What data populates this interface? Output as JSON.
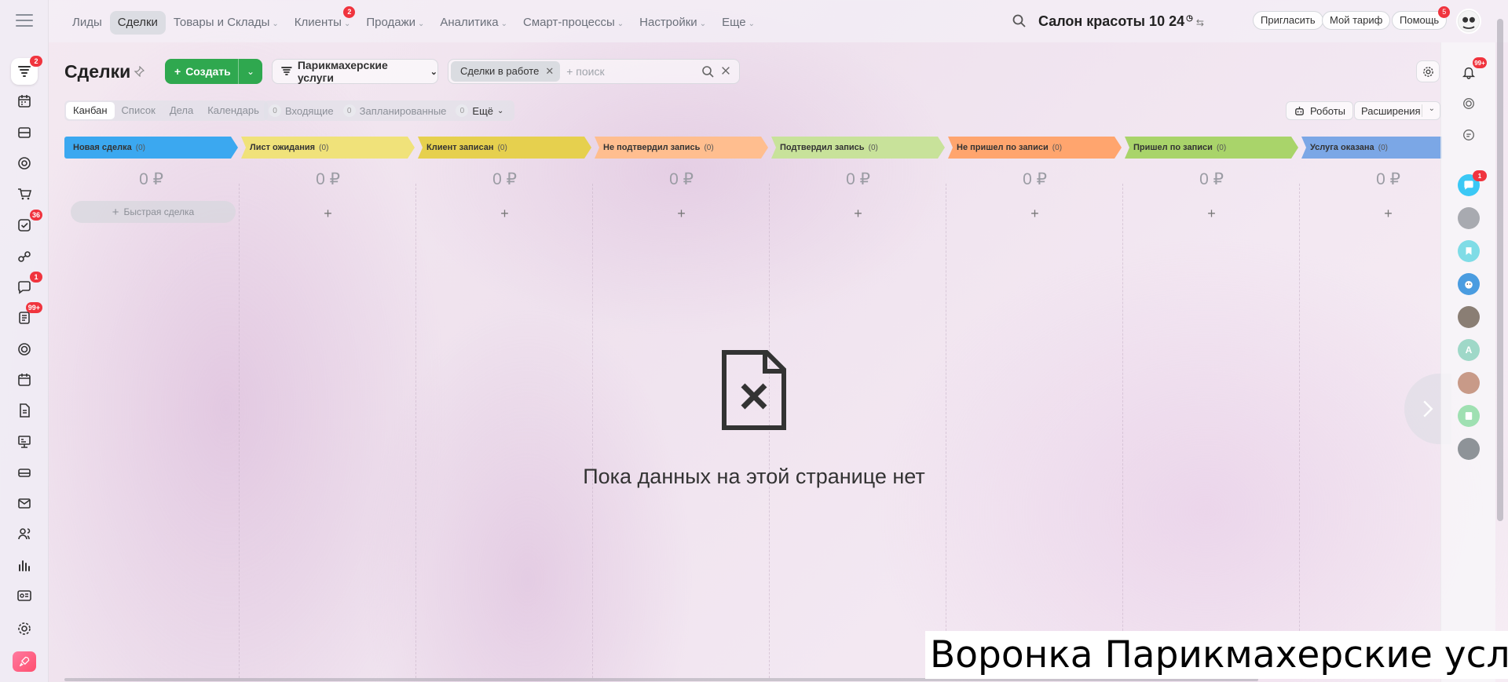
{
  "top_menu": [
    {
      "label": "Лиды",
      "active": false,
      "dropdown": false
    },
    {
      "label": "Сделки",
      "active": true,
      "dropdown": false
    },
    {
      "label": "Товары и Склады",
      "active": false,
      "dropdown": true
    },
    {
      "label": "Клиенты",
      "active": false,
      "dropdown": true,
      "badge": "2"
    },
    {
      "label": "Продажи",
      "active": false,
      "dropdown": true
    },
    {
      "label": "Аналитика",
      "active": false,
      "dropdown": true
    },
    {
      "label": "Смарт-процессы",
      "active": false,
      "dropdown": true
    },
    {
      "label": "Настройки",
      "active": false,
      "dropdown": true
    },
    {
      "label": "Еще",
      "active": false,
      "dropdown": true
    }
  ],
  "header": {
    "company": "Салон красоты 10",
    "clock_time": "24",
    "invite_label": "Пригласить",
    "tariff_label": "Мой тариф",
    "help_label": "Помощь",
    "help_badge": "5"
  },
  "left_nav_badges": {
    "crm": "2",
    "tasks": "36",
    "messenger": "1",
    "feed": "99+"
  },
  "page": {
    "title": "Сделки",
    "create_label": "Создать",
    "pipeline_label": "Парикмахерские услуги",
    "filter_chip": "Сделки в работе",
    "search_placeholder": "+ поиск"
  },
  "view_tabs": [
    "Канбан",
    "Список",
    "Дела",
    "Календарь"
  ],
  "counters": [
    {
      "count": "0",
      "label": "Входящие"
    },
    {
      "count": "0",
      "label": "Запланированные"
    },
    {
      "count": "0",
      "label": "Ещё"
    }
  ],
  "toolbar_right": {
    "robots_label": "Роботы",
    "extensions_label": "Расширения"
  },
  "stages": [
    {
      "name": "Новая сделка",
      "count": "(0)",
      "sum": "0 ₽",
      "color": "#3ba8f0"
    },
    {
      "name": "Лист ожидания",
      "count": "(0)",
      "sum": "0 ₽",
      "color": "#f0e27a"
    },
    {
      "name": "Клиент записан",
      "count": "(0)",
      "sum": "0 ₽",
      "color": "#e6d04e"
    },
    {
      "name": "Не подтвердил запись",
      "count": "(0)",
      "sum": "0 ₽",
      "color": "#ffbe8f"
    },
    {
      "name": "Подтвердил запись",
      "count": "(0)",
      "sum": "0 ₽",
      "color": "#c8e29a"
    },
    {
      "name": "Не пришел по записи",
      "count": "(0)",
      "sum": "0 ₽",
      "color": "#ffa56e"
    },
    {
      "name": "Пришел по записи",
      "count": "(0)",
      "sum": "0 ₽",
      "color": "#a9d46a"
    },
    {
      "name": "Услуга оказана",
      "count": "(0)",
      "sum": "0 ₽",
      "color": "#7ba7e6"
    }
  ],
  "quick_deal_label": "Быстрая сделка",
  "empty_state": "Пока данных на этой странице нет",
  "right_panel": {
    "notifications_badge": "99+",
    "chat_badge": "1",
    "avatar_letter": "A"
  },
  "caption": "Воронка Парикмахерские услуги"
}
